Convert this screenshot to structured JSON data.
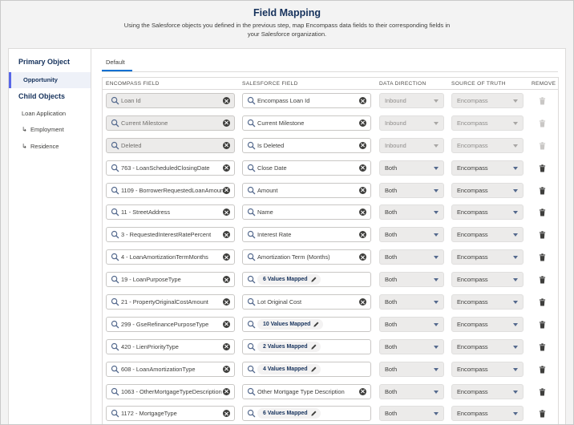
{
  "header": {
    "title": "Field Mapping",
    "subtitle": "Using the Salesforce objects you defined in the previous step, map Encompass data fields to their corresponding fields in your Salesforce organization."
  },
  "sidebar": {
    "primary_heading": "Primary Object",
    "primary_items": [
      {
        "label": "Opportunity",
        "active": true
      }
    ],
    "child_heading": "Child Objects",
    "child_items": [
      {
        "label": "Loan Application"
      },
      {
        "label": "Employment",
        "arrow": "↳"
      },
      {
        "label": "Residence",
        "arrow": "↳"
      }
    ]
  },
  "tabs": [
    {
      "label": "Default",
      "active": true
    }
  ],
  "table": {
    "columns": [
      "ENCOMPASS FIELD",
      "SALESFORCE FIELD",
      "DATA DIRECTION",
      "SOURCE OF TRUTH",
      "REMOVE"
    ],
    "rows": [
      {
        "encompass": "Loan Id",
        "salesforce": "Encompass Loan Id",
        "sf_type": "text",
        "direction": "Inbound",
        "source": "Encompass",
        "locked": true
      },
      {
        "encompass": "Current Milestone",
        "salesforce": "Current Milestone",
        "sf_type": "text",
        "direction": "Inbound",
        "source": "Encompass",
        "locked": true
      },
      {
        "encompass": "Deleted",
        "salesforce": "Is Deleted",
        "sf_type": "text",
        "direction": "Inbound",
        "source": "Encompass",
        "locked": true
      },
      {
        "encompass": "763 - LoanScheduledClosingDate",
        "salesforce": "Close Date",
        "sf_type": "text",
        "direction": "Both",
        "source": "Encompass",
        "locked": false
      },
      {
        "encompass": "1109 - BorrowerRequestedLoanAmount",
        "salesforce": "Amount",
        "sf_type": "text",
        "direction": "Both",
        "source": "Encompass",
        "locked": false
      },
      {
        "encompass": "11 - StreetAddress",
        "salesforce": "Name",
        "sf_type": "text",
        "direction": "Both",
        "source": "Encompass",
        "locked": false
      },
      {
        "encompass": "3 - RequestedInterestRatePercent",
        "salesforce": "Interest Rate",
        "sf_type": "text",
        "direction": "Both",
        "source": "Encompass",
        "locked": false
      },
      {
        "encompass": "4 - LoanAmortizationTermMonths",
        "salesforce": "Amortization Term (Months)",
        "sf_type": "text",
        "direction": "Both",
        "source": "Encompass",
        "locked": false
      },
      {
        "encompass": "19 - LoanPurposeType",
        "salesforce": "6 Values Mapped",
        "sf_type": "pill",
        "direction": "Both",
        "source": "Encompass",
        "locked": false
      },
      {
        "encompass": "21 - PropertyOriginalCostAmount",
        "salesforce": "Lot Original Cost",
        "sf_type": "text",
        "direction": "Both",
        "source": "Encompass",
        "locked": false
      },
      {
        "encompass": "299 - GseRefinancePurposeType",
        "salesforce": "10 Values Mapped",
        "sf_type": "pill",
        "direction": "Both",
        "source": "Encompass",
        "locked": false
      },
      {
        "encompass": "420 - LienPriorityType",
        "salesforce": "2 Values Mapped",
        "sf_type": "pill",
        "direction": "Both",
        "source": "Encompass",
        "locked": false
      },
      {
        "encompass": "608 - LoanAmortizationType",
        "salesforce": "4 Values Mapped",
        "sf_type": "pill",
        "direction": "Both",
        "source": "Encompass",
        "locked": false
      },
      {
        "encompass": "1063 - OtherMortgageTypeDescription",
        "salesforce": "Other Mortgage Type Description",
        "sf_type": "text",
        "direction": "Both",
        "source": "Encompass",
        "locked": false
      },
      {
        "encompass": "1172 - MortgageType",
        "salesforce": "6 Values Mapped",
        "sf_type": "pill",
        "direction": "Both",
        "source": "Encompass",
        "locked": false
      }
    ]
  },
  "icons": {
    "search": "search-icon",
    "clear": "clear-icon",
    "edit": "pencil-icon",
    "remove": "trash-icon",
    "dropdown": "chevron-down-icon"
  },
  "colors": {
    "title": "#16325c",
    "active_accent": "#5867e8",
    "tab_accent": "#0070d2",
    "disabled_field": "#ecebea"
  }
}
